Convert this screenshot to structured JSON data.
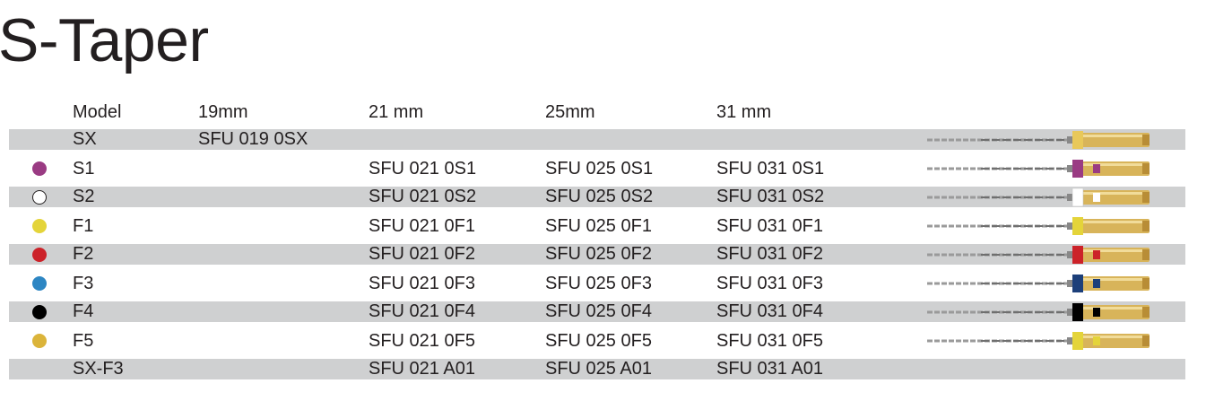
{
  "title": "S-Taper",
  "headers": {
    "model": "Model",
    "len19": "19mm",
    "len21": "21 mm",
    "len25": "25mm",
    "len31": "31 mm"
  },
  "rows": [
    {
      "model": "SX",
      "c19": "SFU 019 0SX",
      "c21": "",
      "c25": "",
      "c31": "",
      "dot": "",
      "band": "#e8c85a",
      "band2": ""
    },
    {
      "model": "S1",
      "c19": "",
      "c21": "SFU 021 0S1",
      "c25": "SFU 025 0S1",
      "c31": "SFU 031 0S1",
      "dot": "#9a3b83",
      "band": "#9a3b83",
      "band2": "#9a3b83"
    },
    {
      "model": "S2",
      "c19": "",
      "c21": "SFU 021 0S2",
      "c25": "SFU 025 0S2",
      "c31": "SFU 031 0S2",
      "dot": "hollow",
      "band": "#ffffff",
      "band2": "#ffffff"
    },
    {
      "model": "F1",
      "c19": "",
      "c21": "SFU 021 0F1",
      "c25": "SFU 025 0F1",
      "c31": "SFU 031 0F1",
      "dot": "#e4d43a",
      "band": "#e4d43a",
      "band2": ""
    },
    {
      "model": "F2",
      "c19": "",
      "c21": "SFU 021 0F2",
      "c25": "SFU 025 0F2",
      "c31": "SFU 031 0F2",
      "dot": "#cc2229",
      "band": "#cc2229",
      "band2": "#cc2229"
    },
    {
      "model": "F3",
      "c19": "",
      "c21": "SFU 021 0F3",
      "c25": "SFU 025 0F3",
      "c31": "SFU 031 0F3",
      "dot": "#2d86c3",
      "band": "#1c3f7a",
      "band2": "#1c3f7a"
    },
    {
      "model": "F4",
      "c19": "",
      "c21": "SFU 021 0F4",
      "c25": "SFU 025 0F4",
      "c31": "SFU 031 0F4",
      "dot": "#000000",
      "band": "#000000",
      "band2": "#000000"
    },
    {
      "model": "F5",
      "c19": "",
      "c21": "SFU 021 0F5",
      "c25": "SFU 025 0F5",
      "c31": "SFU 031 0F5",
      "dot": "#dbb43a",
      "band": "#e4d43a",
      "band2": "#e4d43a"
    },
    {
      "model": "SX-F3",
      "c19": "",
      "c21": "SFU 021 A01",
      "c25": "SFU 025 A01",
      "c31": "SFU 031 A01",
      "dot": "",
      "band": "",
      "band2": ""
    }
  ],
  "colors": {
    "shade": "#cfd0d1",
    "gold": "#d8b45a",
    "text": "#231f20"
  }
}
